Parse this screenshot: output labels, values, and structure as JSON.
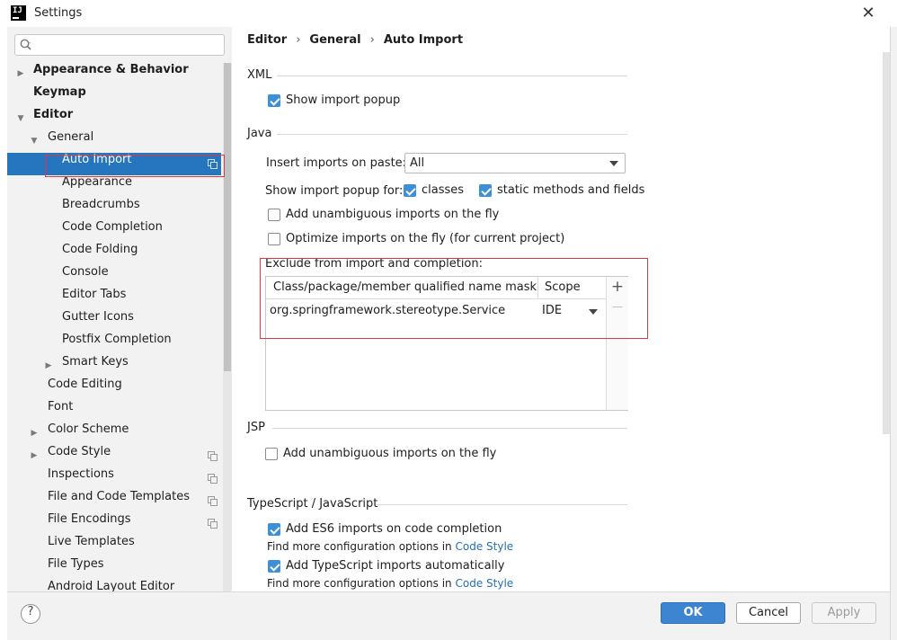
{
  "window": {
    "title": "Settings",
    "app_icon_text": "IJ",
    "close_glyph": "✕"
  },
  "colors": {
    "selection": "#2675bf",
    "highlight_frame": "#e0383e",
    "checkbox_checked": "#3d8fd6",
    "ok_button": "#3d84d1",
    "link": "#2470b3"
  },
  "sidebar": {
    "search_value": "",
    "items": [
      {
        "label": "Appearance & Behavior",
        "bold": true,
        "arrow": "right",
        "level": 0,
        "selected": false,
        "copy_icon": false
      },
      {
        "label": "Keymap",
        "bold": true,
        "arrow": "none",
        "level": 0,
        "selected": false,
        "copy_icon": false
      },
      {
        "label": "Editor",
        "bold": true,
        "arrow": "down",
        "level": 0,
        "selected": false,
        "copy_icon": false
      },
      {
        "label": "General",
        "bold": false,
        "arrow": "down",
        "level": 1,
        "selected": false,
        "copy_icon": false
      },
      {
        "label": "Auto Import",
        "bold": false,
        "arrow": "none",
        "level": 2,
        "selected": true,
        "copy_icon": true
      },
      {
        "label": "Appearance",
        "bold": false,
        "arrow": "none",
        "level": 2,
        "selected": false,
        "copy_icon": false
      },
      {
        "label": "Breadcrumbs",
        "bold": false,
        "arrow": "none",
        "level": 2,
        "selected": false,
        "copy_icon": false
      },
      {
        "label": "Code Completion",
        "bold": false,
        "arrow": "none",
        "level": 2,
        "selected": false,
        "copy_icon": false
      },
      {
        "label": "Code Folding",
        "bold": false,
        "arrow": "none",
        "level": 2,
        "selected": false,
        "copy_icon": false
      },
      {
        "label": "Console",
        "bold": false,
        "arrow": "none",
        "level": 2,
        "selected": false,
        "copy_icon": false
      },
      {
        "label": "Editor Tabs",
        "bold": false,
        "arrow": "none",
        "level": 2,
        "selected": false,
        "copy_icon": false
      },
      {
        "label": "Gutter Icons",
        "bold": false,
        "arrow": "none",
        "level": 2,
        "selected": false,
        "copy_icon": false
      },
      {
        "label": "Postfix Completion",
        "bold": false,
        "arrow": "none",
        "level": 2,
        "selected": false,
        "copy_icon": false
      },
      {
        "label": "Smart Keys",
        "bold": false,
        "arrow": "right",
        "level": 2,
        "selected": false,
        "copy_icon": false
      },
      {
        "label": "Code Editing",
        "bold": false,
        "arrow": "none",
        "level": 1,
        "selected": false,
        "copy_icon": false
      },
      {
        "label": "Font",
        "bold": false,
        "arrow": "none",
        "level": 1,
        "selected": false,
        "copy_icon": false
      },
      {
        "label": "Color Scheme",
        "bold": false,
        "arrow": "right",
        "level": 1,
        "selected": false,
        "copy_icon": false
      },
      {
        "label": "Code Style",
        "bold": false,
        "arrow": "right",
        "level": 1,
        "selected": false,
        "copy_icon": true
      },
      {
        "label": "Inspections",
        "bold": false,
        "arrow": "none",
        "level": 1,
        "selected": false,
        "copy_icon": true
      },
      {
        "label": "File and Code Templates",
        "bold": false,
        "arrow": "none",
        "level": 1,
        "selected": false,
        "copy_icon": true
      },
      {
        "label": "File Encodings",
        "bold": false,
        "arrow": "none",
        "level": 1,
        "selected": false,
        "copy_icon": true
      },
      {
        "label": "Live Templates",
        "bold": false,
        "arrow": "none",
        "level": 1,
        "selected": false,
        "copy_icon": false
      },
      {
        "label": "File Types",
        "bold": false,
        "arrow": "none",
        "level": 1,
        "selected": false,
        "copy_icon": false
      },
      {
        "label": "Android Layout Editor",
        "bold": false,
        "arrow": "none",
        "level": 1,
        "selected": false,
        "copy_icon": false
      }
    ]
  },
  "breadcrumb": {
    "items": [
      "Editor",
      "General",
      "Auto Import"
    ],
    "separator": "›"
  },
  "xml": {
    "title": "XML",
    "show_import_popup": {
      "label": "Show import popup",
      "checked": true
    }
  },
  "java": {
    "title": "Java",
    "insert_imports_label": "Insert imports on paste:",
    "insert_imports_value": "All",
    "show_popup_for_label": "Show import popup for:",
    "classes": {
      "label": "classes",
      "checked": true
    },
    "static_methods": {
      "label": "static methods and fields",
      "checked": true
    },
    "add_unambiguous": {
      "label": "Add unambiguous imports on the fly",
      "checked": false
    },
    "optimize_imports": {
      "label": "Optimize imports on the fly (for current project)",
      "checked": false
    },
    "exclude_label": "Exclude from import and completion:",
    "exclude_table": {
      "columns": [
        "Class/package/member qualified name mask",
        "Scope"
      ],
      "rows": [
        {
          "mask": "org.springframework.stereotype.Service",
          "scope": "IDE"
        }
      ],
      "add_glyph": "+",
      "remove_glyph": "—"
    }
  },
  "jsp": {
    "title": "JSP",
    "add_unambiguous": {
      "label": "Add unambiguous imports on the fly",
      "checked": false
    }
  },
  "typescript": {
    "title": "TypeScript / JavaScript",
    "es6_imports": {
      "label": "Add ES6 imports on code completion",
      "checked": true
    },
    "find_more_1": "Find more configuration options in",
    "link_1": "Code Style",
    "ts_imports": {
      "label": "Add TypeScript imports automatically",
      "checked": true
    },
    "find_more_2": "Find more configuration options in",
    "link_2": "Code Style"
  },
  "footer": {
    "help_glyph": "?",
    "ok": "OK",
    "cancel": "Cancel",
    "apply": "Apply"
  }
}
